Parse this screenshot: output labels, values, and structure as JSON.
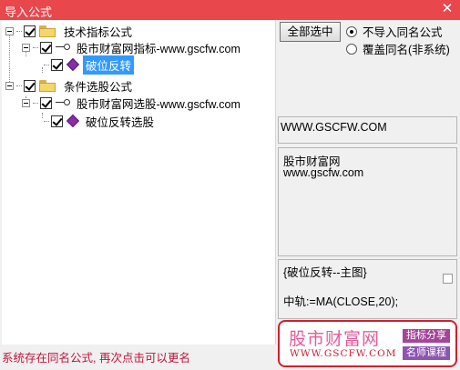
{
  "window": {
    "title": "导入公式",
    "close_glyph": "✕"
  },
  "tree": {
    "nodes": [
      {
        "label": "技术指标公式",
        "checked": true,
        "icon": "folder-icon"
      },
      {
        "label": "股市财富网指标-www.gscfw.com",
        "checked": true,
        "icon": "key-icon"
      },
      {
        "label": "破位反转",
        "checked": true,
        "icon": "formula-gem-icon",
        "selected": true
      },
      {
        "label": "条件选股公式",
        "checked": true,
        "icon": "folder-icon"
      },
      {
        "label": "股市财富网选股-www.gscfw.com",
        "checked": true,
        "icon": "key-icon"
      },
      {
        "label": "破位反转选股",
        "checked": true,
        "icon": "formula-gem-icon"
      }
    ]
  },
  "controls": {
    "select_all_label": "全部选中",
    "radio_skip_label": "不导入同名公式",
    "radio_overwrite_label": "覆盖同名(非系统)",
    "selected_radio": "skip"
  },
  "info": {
    "website": "WWW.GSCFW.COM",
    "description_line1": "股市财富网",
    "description_line2": "www.gscfw.com",
    "formula_title": "{破位反转--主图}",
    "formula_line": "中轨:=MA(CLOSE,20);"
  },
  "ad": {
    "brand": "股市财富网",
    "url": "WWW.GSCFW.COM",
    "tag1": "指标分享",
    "tag2": "名师课程"
  },
  "status": {
    "message": "系统存在同名公式, 再次点击可以更名"
  },
  "colors": {
    "titlebar": "#e8474b",
    "selection": "#3399ff",
    "status_text": "#c0143c",
    "ad_border": "#d01f2e"
  }
}
